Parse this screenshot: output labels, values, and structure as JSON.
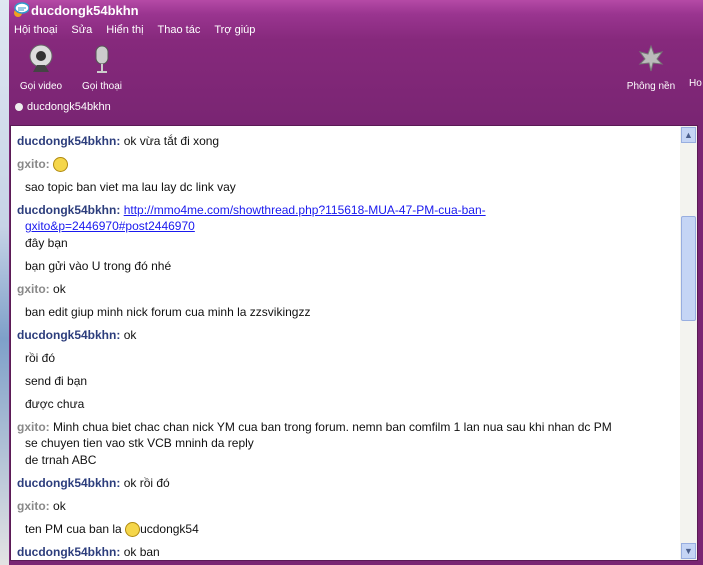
{
  "window": {
    "title": "ducdongk54bkhn"
  },
  "menu": [
    "Hội thoại",
    "Sửa",
    "Hiển thị",
    "Thao tác",
    "Trợ giúp"
  ],
  "toolbar": {
    "video": "Gọi video",
    "voice": "Gọi thoại",
    "wallpaper": "Phông nền",
    "more": "Ho"
  },
  "status": {
    "contact": "ducdongk54bkhn"
  },
  "messages": [
    {
      "sender": "ducdongk54bkhn:",
      "text": "ok vừa tắt đi xong"
    },
    {
      "sender": "gxito:",
      "text": ""
    },
    {
      "text": "sao topic ban viet ma lau lay dc link vay"
    },
    {
      "sender": "ducdongk54bkhn:",
      "link1": "http://mmo4me.com/showthread.php?115618-MUA-47-PM-cua-ban-",
      "link2": "gxito&p=2446970#post2446970"
    },
    {
      "text": "đây bạn"
    },
    {
      "text": "bạn gửi vào U trong đó nhé"
    },
    {
      "sender": "gxito:",
      "text": "ok"
    },
    {
      "text": "ban edit giup minh nick forum cua minh la  zzsvikingzz"
    },
    {
      "sender": "ducdongk54bkhn:",
      "text": "ok"
    },
    {
      "text": "rồi đó"
    },
    {
      "text": "send đi bạn"
    },
    {
      "text": "được chưa"
    },
    {
      "sender": "gxito:",
      "text": "Minh chua biet chac chan nick YM cua ban trong forum. nemn ban comfilm 1 lan nua sau khi nhan dc PM",
      "cont": "se chuyen tien vao stk VCB mninh da reply"
    },
    {
      "text": "de trnah ABC"
    },
    {
      "sender": "ducdongk54bkhn:",
      "text": "ok rồi đó"
    },
    {
      "sender": "gxito:",
      "text": "ok"
    },
    {
      "text": "ten PM cua ban la ",
      "after": "ucdongk54"
    },
    {
      "sender": "ducdongk54bkhn:",
      "text": "ok ban"
    }
  ]
}
